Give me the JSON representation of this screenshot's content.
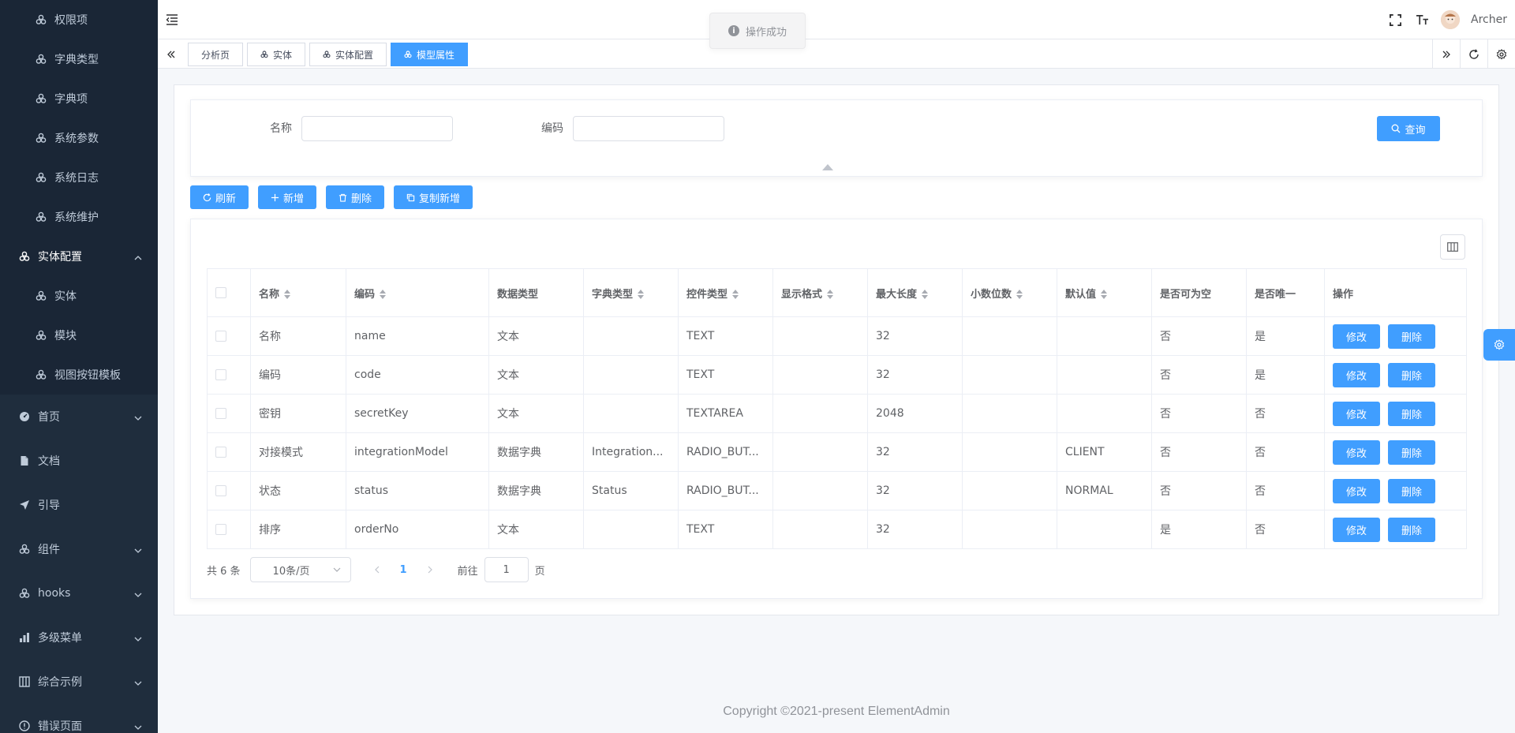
{
  "sidebar": {
    "top_sub_items": [
      {
        "label": "权限项",
        "icon": "component-icon"
      },
      {
        "label": "字典类型",
        "icon": "component-icon"
      },
      {
        "label": "字典项",
        "icon": "component-icon"
      },
      {
        "label": "系统参数",
        "icon": "component-icon"
      },
      {
        "label": "系统日志",
        "icon": "component-icon"
      },
      {
        "label": "系统维护",
        "icon": "component-icon"
      }
    ],
    "entity_config": {
      "label": "实体配置",
      "children": [
        "实体",
        "模块",
        "视图按钮模板"
      ]
    },
    "menus": [
      {
        "label": "首页",
        "icon": "dashboard-icon",
        "expandable": true
      },
      {
        "label": "文档",
        "icon": "document-icon",
        "expandable": false
      },
      {
        "label": "引导",
        "icon": "guide-icon",
        "expandable": false
      },
      {
        "label": "组件",
        "icon": "component-icon",
        "expandable": true
      },
      {
        "label": "hooks",
        "icon": "component-icon",
        "expandable": true
      },
      {
        "label": "多级菜单",
        "icon": "chart-icon",
        "expandable": true
      },
      {
        "label": "综合示例",
        "icon": "table-icon",
        "expandable": true
      },
      {
        "label": "错误页面",
        "icon": "error-icon",
        "expandable": true
      }
    ]
  },
  "header": {
    "username": "Archer"
  },
  "toast": {
    "message": "操作成功"
  },
  "tags": [
    {
      "label": "分析页",
      "active": false,
      "icon": false
    },
    {
      "label": "实体",
      "active": false,
      "icon": true
    },
    {
      "label": "实体配置",
      "active": false,
      "icon": true
    },
    {
      "label": "模型属性",
      "active": true,
      "icon": true
    }
  ],
  "search": {
    "name_label": "名称",
    "code_label": "编码",
    "query_button": "查询"
  },
  "toolbar": {
    "refresh": "刷新",
    "add": "新增",
    "delete": "删除",
    "copy_add": "复制新增"
  },
  "table": {
    "columns": [
      {
        "label": "名称",
        "sortable": true
      },
      {
        "label": "编码",
        "sortable": true
      },
      {
        "label": "数据类型",
        "sortable": false
      },
      {
        "label": "字典类型",
        "sortable": true
      },
      {
        "label": "控件类型",
        "sortable": true
      },
      {
        "label": "显示格式",
        "sortable": true
      },
      {
        "label": "最大长度",
        "sortable": true
      },
      {
        "label": "小数位数",
        "sortable": true
      },
      {
        "label": "默认值",
        "sortable": true
      },
      {
        "label": "是否可为空",
        "sortable": false
      },
      {
        "label": "是否唯一",
        "sortable": false
      },
      {
        "label": "操作",
        "sortable": false
      }
    ],
    "rows": [
      [
        "名称",
        "name",
        "文本",
        "",
        "TEXT",
        "",
        "32",
        "",
        "",
        "否",
        "是"
      ],
      [
        "编码",
        "code",
        "文本",
        "",
        "TEXT",
        "",
        "32",
        "",
        "",
        "否",
        "是"
      ],
      [
        "密钥",
        "secretKey",
        "文本",
        "",
        "TEXTAREA",
        "",
        "2048",
        "",
        "",
        "否",
        "否"
      ],
      [
        "对接模式",
        "integrationModel",
        "数据字典",
        "Integration...",
        "RADIO_BUT...",
        "",
        "32",
        "",
        "CLIENT",
        "否",
        "否"
      ],
      [
        "状态",
        "status",
        "数据字典",
        "Status",
        "RADIO_BUT...",
        "",
        "32",
        "",
        "NORMAL",
        "否",
        "否"
      ],
      [
        "排序",
        "orderNo",
        "文本",
        "",
        "TEXT",
        "",
        "32",
        "",
        "",
        "是",
        "否"
      ]
    ],
    "edit_label": "修改",
    "delete_label": "删除"
  },
  "pagination": {
    "total_text": "共 6 条",
    "page_size": "10条/页",
    "current_page": "1",
    "goto_prefix": "前往",
    "goto_value": "1",
    "goto_suffix": "页"
  },
  "footer": {
    "copyright": "Copyright ©2021-present ElementAdmin"
  },
  "colors": {
    "primary": "#409eff",
    "sidebar_bg": "#1f2d3d",
    "sidebar_text": "#bfcbd9"
  }
}
